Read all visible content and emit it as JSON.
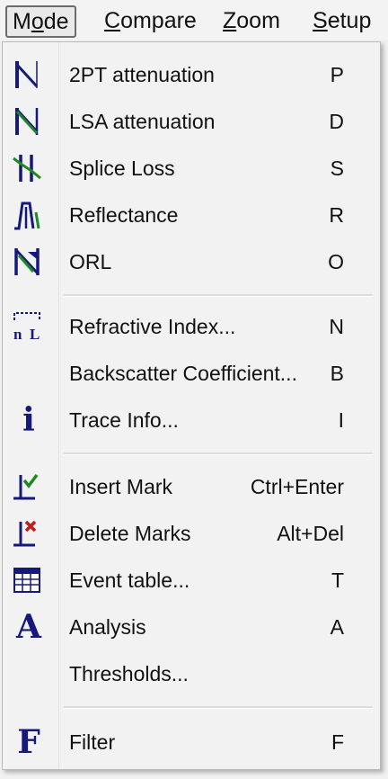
{
  "menubar": {
    "items": [
      {
        "pre": "M",
        "mn": "o",
        "post": "de"
      },
      {
        "pre": "",
        "mn": "C",
        "post": "ompare"
      },
      {
        "pre": "",
        "mn": "Z",
        "post": "oom"
      },
      {
        "pre": "",
        "mn": "S",
        "post": "etup"
      }
    ]
  },
  "menu": {
    "items": [
      {
        "label": "2PT attenuation",
        "shortcut": "P",
        "icon": "two-point-attenuation-icon"
      },
      {
        "label": "LSA attenuation",
        "shortcut": "D",
        "icon": "lsa-attenuation-icon"
      },
      {
        "label": "Splice Loss",
        "shortcut": "S",
        "icon": "splice-loss-icon"
      },
      {
        "label": "Reflectance",
        "shortcut": "R",
        "icon": "reflectance-icon"
      },
      {
        "label": "ORL",
        "shortcut": "O",
        "icon": "orl-icon"
      },
      {
        "label": "Refractive Index...",
        "shortcut": "N",
        "icon": "refractive-index-icon"
      },
      {
        "label": "Backscatter Coefficient...",
        "shortcut": "B",
        "icon": ""
      },
      {
        "label": "Trace Info...",
        "shortcut": "I",
        "icon": "info-icon"
      },
      {
        "label": "Insert Mark",
        "shortcut": "Ctrl+Enter",
        "icon": "insert-mark-icon"
      },
      {
        "label": "Delete Marks",
        "shortcut": "Alt+Del",
        "icon": "delete-marks-icon"
      },
      {
        "label": "Event table...",
        "shortcut": "T",
        "icon": "event-table-icon"
      },
      {
        "label": "Analysis",
        "shortcut": "A",
        "icon": "analysis-icon"
      },
      {
        "label": "Thresholds...",
        "shortcut": "",
        "icon": ""
      },
      {
        "label": "Filter",
        "shortcut": "F",
        "icon": "filter-icon"
      }
    ]
  },
  "icons": {
    "refractive_index_left": "n",
    "refractive_index_right": "L",
    "info_glyph": "i",
    "analysis_glyph": "A",
    "filter_glyph": "F"
  },
  "colors": {
    "icon_navy": "#16187a",
    "icon_green": "#1f8a1f",
    "delete_red": "#c41a1a"
  }
}
